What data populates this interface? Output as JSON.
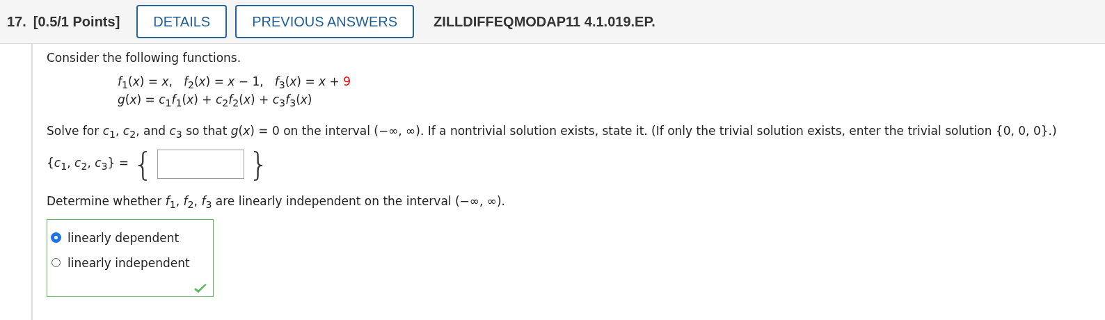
{
  "header": {
    "number": "17.",
    "points": "[0.5/1 Points]",
    "buttons": [
      "DETAILS",
      "PREVIOUS ANSWERS"
    ],
    "code": "ZILLDIFFEQMODAP11 4.1.019.EP."
  },
  "intro": "Consider the following functions.",
  "functions": [
    {
      "expression": "*f*$_{1}$(*x*) = *x*,"
    },
    {
      "expression": "*f*$_{2}$(*x*) = *x* − 1,"
    },
    {
      "expression": "*f*$_{3}$(*x*) = *x* + ",
      "highlight": "9"
    }
  ],
  "combination": "*g*(*x*) = *c*$_{1}$*f*$_{1}$(*x*) + *c*$_{2}$*f*$_{2}$(*x*) + *c*$_{3}$*f*$_{3}$(*x*)",
  "instruction": "Solve for *c*$_{1}$, *c*$_{2}$, and *c*$_{3}$ so that *g*(*x*) = 0 on the interval (−∞, ∞). If a nontrivial solution exists, state it. (If only the trivial solution exists, enter the trivial solution {0, 0, 0}.)",
  "answer": {
    "label": "{*c*$_{1}$, *c*$_{2}$, *c*$_{3}$} =",
    "open_brace": "{",
    "close_brace": "}"
  },
  "question": "Determine whether *f*$_{1}$, *f*$_{2}$, *f*$_{3}$ are linearly independent on the interval (−∞, ∞).",
  "choices": {
    "graded_correct": true,
    "options": [
      {
        "label": "linearly dependent",
        "selected": true
      },
      {
        "label": "linearly independent",
        "selected": false
      }
    ]
  }
}
